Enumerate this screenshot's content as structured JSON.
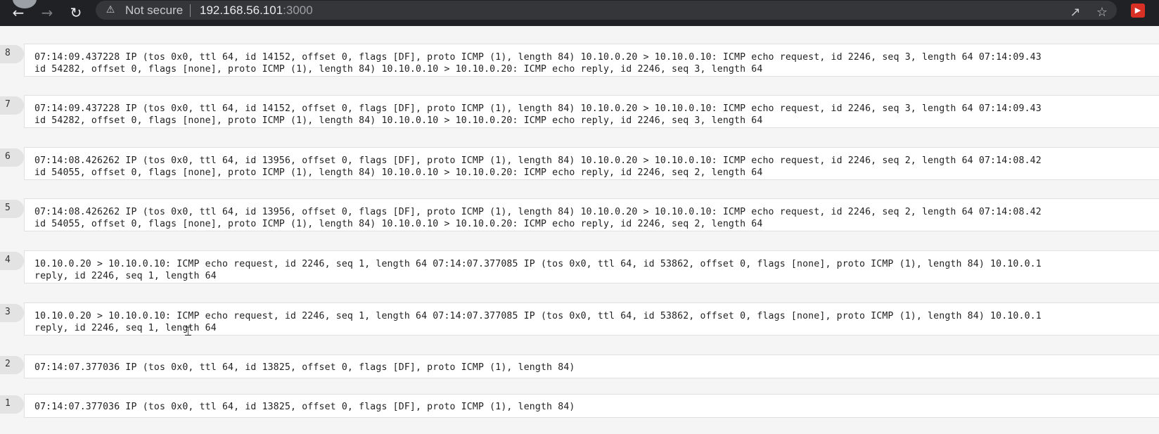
{
  "browser": {
    "security_label": "Not secure",
    "url_host": "192.168.56.101",
    "url_port": ":3000",
    "icons": [
      "back-icon",
      "forward-icon",
      "reload-icon",
      "warning-icon",
      "share-icon",
      "star-icon",
      "extension-icon"
    ]
  },
  "rows": [
    {
      "num": "8",
      "line1": "07:14:09.437228 IP (tos 0x0, ttl 64, id 14152, offset 0, flags [DF], proto ICMP (1), length 84) 10.10.0.20 > 10.10.0.10: ICMP echo request, id 2246, seq 3, length 64 07:14:09.43",
      "line2": "id 54282, offset 0, flags [none], proto ICMP (1), length 84) 10.10.0.10 > 10.10.0.20: ICMP echo reply, id 2246, seq 3, length 64"
    },
    {
      "num": "7",
      "line1": "07:14:09.437228 IP (tos 0x0, ttl 64, id 14152, offset 0, flags [DF], proto ICMP (1), length 84) 10.10.0.20 > 10.10.0.10: ICMP echo request, id 2246, seq 3, length 64 07:14:09.43",
      "line2": "id 54282, offset 0, flags [none], proto ICMP (1), length 84) 10.10.0.10 > 10.10.0.20: ICMP echo reply, id 2246, seq 3, length 64"
    },
    {
      "num": "6",
      "line1": "07:14:08.426262 IP (tos 0x0, ttl 64, id 13956, offset 0, flags [DF], proto ICMP (1), length 84) 10.10.0.20 > 10.10.0.10: ICMP echo request, id 2246, seq 2, length 64 07:14:08.42",
      "line2": "id 54055, offset 0, flags [none], proto ICMP (1), length 84) 10.10.0.10 > 10.10.0.20: ICMP echo reply, id 2246, seq 2, length 64"
    },
    {
      "num": "5",
      "line1": "07:14:08.426262 IP (tos 0x0, ttl 64, id 13956, offset 0, flags [DF], proto ICMP (1), length 84) 10.10.0.20 > 10.10.0.10: ICMP echo request, id 2246, seq 2, length 64 07:14:08.42",
      "line2": "id 54055, offset 0, flags [none], proto ICMP (1), length 84) 10.10.0.10 > 10.10.0.20: ICMP echo reply, id 2246, seq 2, length 64"
    },
    {
      "num": "4",
      "line1": "10.10.0.20 > 10.10.0.10: ICMP echo request, id 2246, seq 1, length 64 07:14:07.377085 IP (tos 0x0, ttl 64, id 53862, offset 0, flags [none], proto ICMP (1), length 84) 10.10.0.1",
      "line2": "reply, id 2246, seq 1, length 64"
    },
    {
      "num": "3",
      "line1": "10.10.0.20 > 10.10.0.10: ICMP echo request, id 2246, seq 1, length 64 07:14:07.377085 IP (tos 0x0, ttl 64, id 53862, offset 0, flags [none], proto ICMP (1), length 84) 10.10.0.1",
      "line2": "reply, id 2246, seq 1, length 64"
    },
    {
      "num": "2",
      "line1": "07:14:07.377036 IP (tos 0x0, ttl 64, id 13825, offset 0, flags [DF], proto ICMP (1), length 84)",
      "line2": ""
    },
    {
      "num": "1",
      "line1": "07:14:07.377036 IP (tos 0x0, ttl 64, id 13825, offset 0, flags [DF], proto ICMP (1), length 84)",
      "line2": ""
    }
  ]
}
